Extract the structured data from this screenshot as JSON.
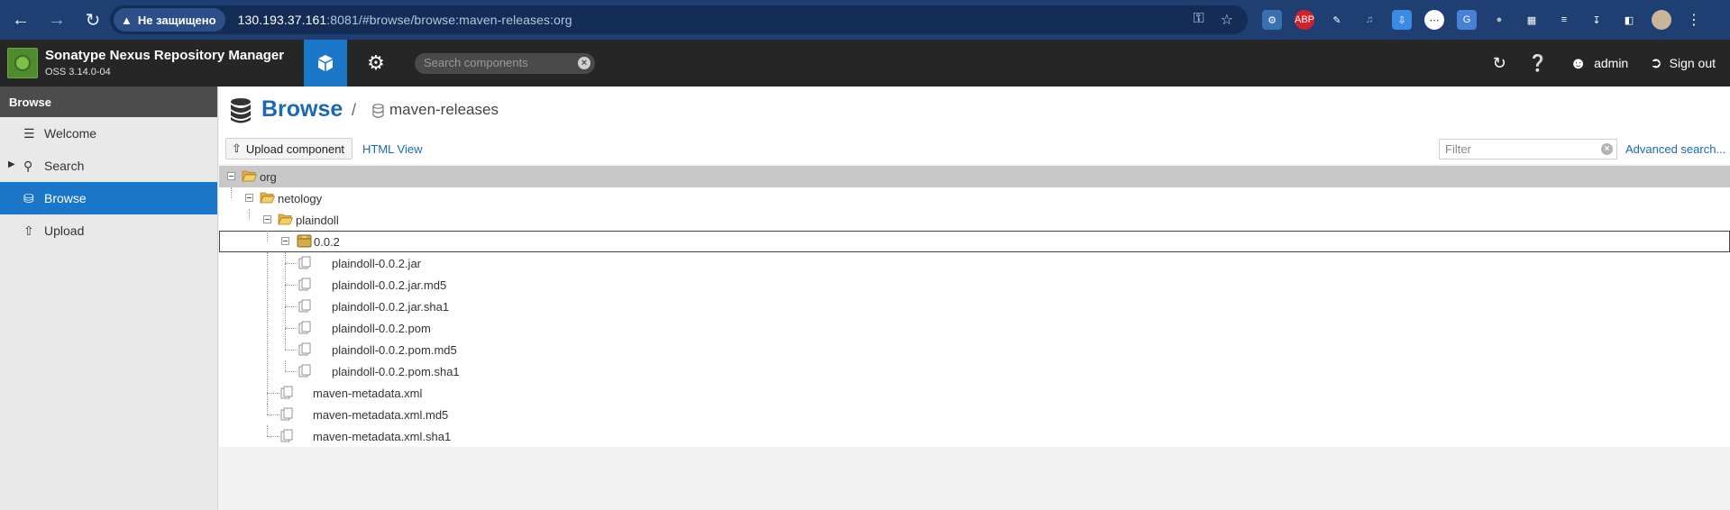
{
  "browser": {
    "security_label": "Не защищено",
    "url_host": "130.193.37.161",
    "url_rest": ":8081/#browse/browse:maven-releases:org"
  },
  "app": {
    "title": "Sonatype Nexus Repository Manager",
    "version": "OSS 3.14.0-04",
    "search_placeholder": "Search components",
    "user": "admin",
    "signout": "Sign out"
  },
  "sidebar": {
    "header": "Browse",
    "items": [
      {
        "label": "Welcome",
        "icon": "list-icon"
      },
      {
        "label": "Search",
        "icon": "search-icon"
      },
      {
        "label": "Browse",
        "icon": "database-icon"
      },
      {
        "label": "Upload",
        "icon": "upload-icon"
      }
    ]
  },
  "main": {
    "title": "Browse",
    "separator": "/",
    "repository": "maven-releases",
    "upload_button": "Upload component",
    "html_view": "HTML View",
    "filter_placeholder": "Filter",
    "advanced_search": "Advanced search..."
  },
  "tree": [
    {
      "label": "org",
      "type": "folder",
      "depth": 0,
      "selected": true
    },
    {
      "label": "netology",
      "type": "folder",
      "depth": 1
    },
    {
      "label": "plaindoll",
      "type": "folder",
      "depth": 2
    },
    {
      "label": "0.0.2",
      "type": "component",
      "depth": 3,
      "focused": true
    },
    {
      "label": "plaindoll-0.0.2.jar",
      "type": "file",
      "depth": 4
    },
    {
      "label": "plaindoll-0.0.2.jar.md5",
      "type": "file",
      "depth": 4
    },
    {
      "label": "plaindoll-0.0.2.jar.sha1",
      "type": "file",
      "depth": 4
    },
    {
      "label": "plaindoll-0.0.2.pom",
      "type": "file",
      "depth": 4
    },
    {
      "label": "plaindoll-0.0.2.pom.md5",
      "type": "file",
      "depth": 4
    },
    {
      "label": "plaindoll-0.0.2.pom.sha1",
      "type": "file",
      "depth": 4
    },
    {
      "label": "maven-metadata.xml",
      "type": "file",
      "depth": 3
    },
    {
      "label": "maven-metadata.xml.md5",
      "type": "file",
      "depth": 3
    },
    {
      "label": "maven-metadata.xml.sha1",
      "type": "file",
      "depth": 3
    }
  ]
}
